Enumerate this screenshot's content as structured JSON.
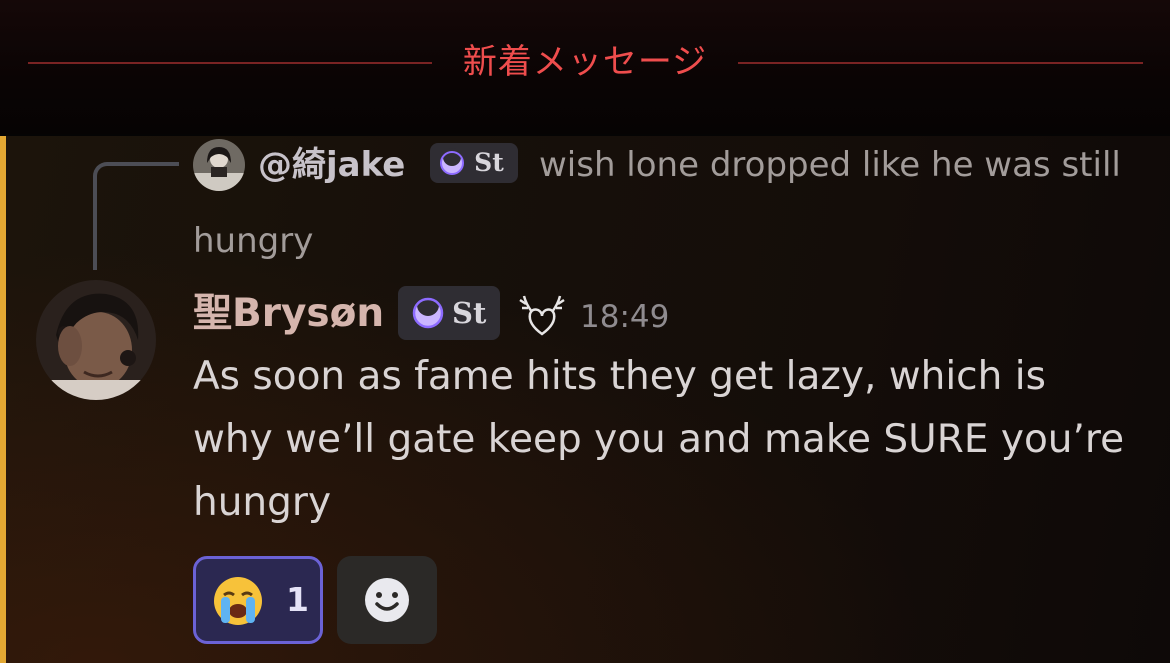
{
  "divider": {
    "label": "新着メッセージ"
  },
  "reply": {
    "author": "@綺jake",
    "tag": "St",
    "text_first_line": "wish lone dropped like he was still",
    "text_second_line": "hungry"
  },
  "message": {
    "author": "聖Brysøn",
    "tag": "St",
    "timestamp": "18:49",
    "lines": [
      "As soon as fame hits they get lazy, which is",
      "why we’ll gate keep you and make SURE you’re",
      "hungry"
    ]
  },
  "reactions": [
    {
      "emoji": "loudly-crying-face",
      "count": "1",
      "selected": true
    }
  ],
  "add_reaction": {
    "icon": "smiley-add-icon"
  },
  "colors": {
    "highlight_bar": "#e3a833",
    "divider": "#ef4d4d",
    "reaction_border": "#6b62d6"
  }
}
